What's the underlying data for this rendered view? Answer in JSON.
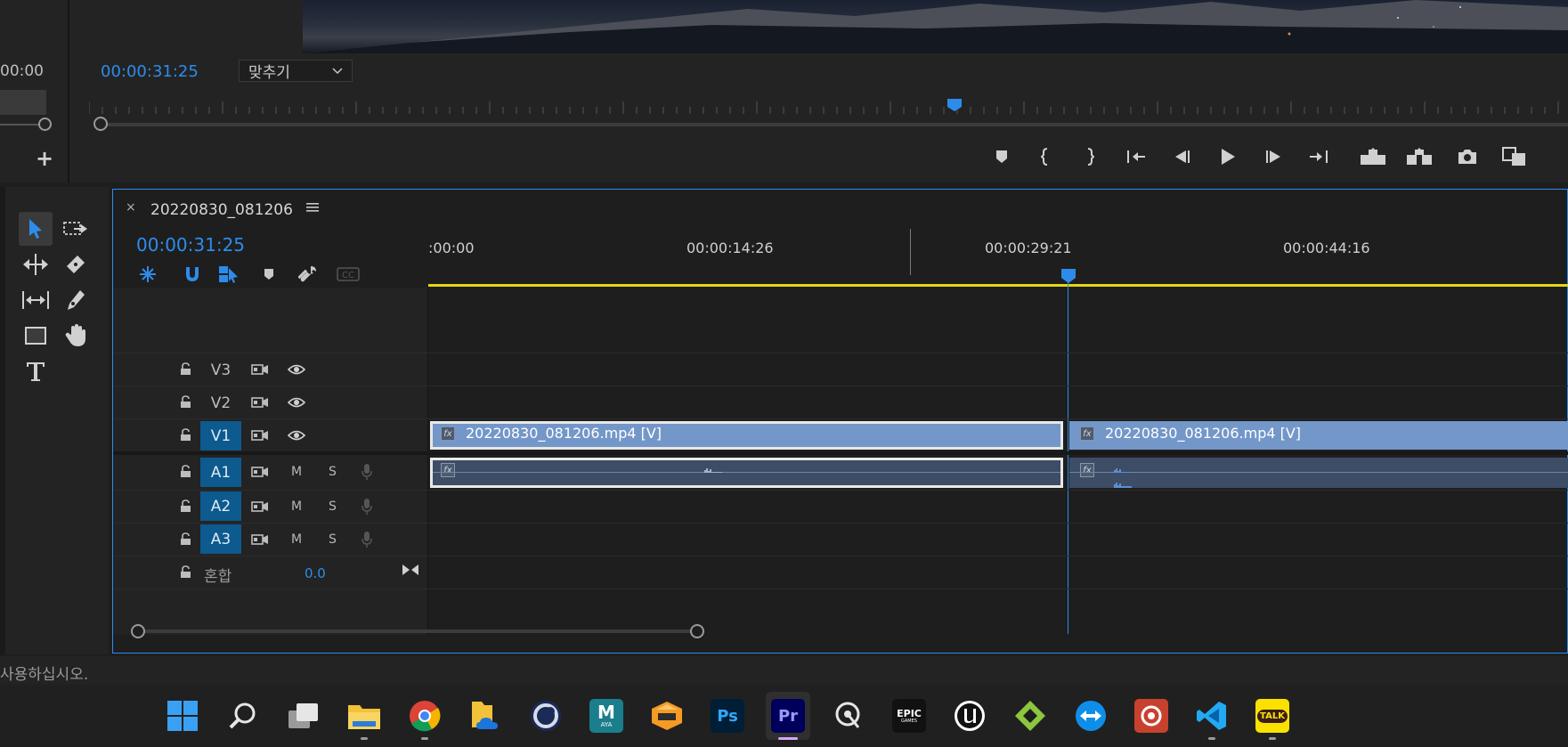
{
  "program_monitor": {
    "left_timecode": "00:00",
    "timecode": "00:00:31:25",
    "fit_label": "맞추기",
    "playhead_position": 0.495
  },
  "transport": {
    "buttons": [
      "add-marker",
      "mark-in",
      "mark-out",
      "go-to-in",
      "step-back",
      "play",
      "step-forward",
      "go-to-out",
      "lift",
      "extract",
      "export-frame",
      "compare-view"
    ]
  },
  "tools": [
    "selection",
    "track-select-forward",
    "ripple-edit",
    "razor",
    "slip",
    "pen",
    "rectangle",
    "hand",
    "type"
  ],
  "timeline": {
    "sequence_name": "20220830_081206",
    "timecode": "00:00:31:25",
    "ruler_labels": [
      ":00:00",
      "00:00:14:26",
      "00:00:29:21",
      "00:00:44:16"
    ],
    "tracks": {
      "video": [
        "V3",
        "V2",
        "V1"
      ],
      "audio": [
        "A1",
        "A2",
        "A3"
      ],
      "mute": "M",
      "solo": "S",
      "mix_label": "혼합",
      "mix_value": "0.0"
    },
    "clips": {
      "v1_a": "20220830_081206.mp4 [V]",
      "v1_b": "20220830_081206.mp4 [V]",
      "fx": "fx"
    }
  },
  "status_bar": {
    "text": "사용하십시오."
  },
  "taskbar": {
    "apps": [
      {
        "name": "windows-start",
        "label": ""
      },
      {
        "name": "search",
        "label": ""
      },
      {
        "name": "task-view",
        "label": ""
      },
      {
        "name": "file-explorer",
        "label": ""
      },
      {
        "name": "chrome",
        "label": ""
      },
      {
        "name": "onedrive-folder",
        "label": ""
      },
      {
        "name": "cinema4d",
        "label": ""
      },
      {
        "name": "maya",
        "label": "M",
        "sub": "AYA"
      },
      {
        "name": "blender-like",
        "label": ""
      },
      {
        "name": "photoshop",
        "label": "Ps"
      },
      {
        "name": "premiere",
        "label": "Pr"
      },
      {
        "name": "quixel",
        "label": ""
      },
      {
        "name": "epic-games",
        "label": "EPIC",
        "sub": "GAMES"
      },
      {
        "name": "unreal",
        "label": ""
      },
      {
        "name": "substance",
        "label": ""
      },
      {
        "name": "teamviewer",
        "label": ""
      },
      {
        "name": "davinci",
        "label": ""
      },
      {
        "name": "vscode",
        "label": ""
      },
      {
        "name": "kakaotalk",
        "label": "TALK"
      }
    ]
  },
  "colors": {
    "accent": "#2d8ceb",
    "timecode": "#2d8ceb",
    "video_clip": "#7397c9",
    "audio_clip": "#3d4d65",
    "work_area": "#e6d70e",
    "track_on": "#0c5a8e"
  }
}
